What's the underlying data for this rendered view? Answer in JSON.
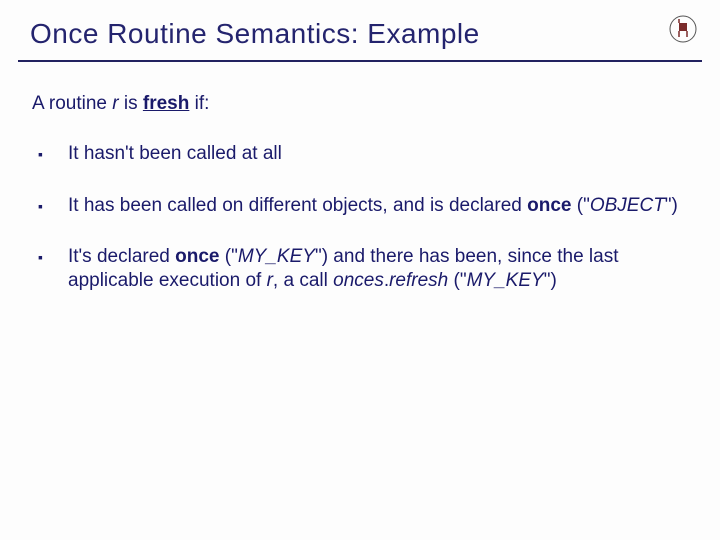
{
  "title": "Once Routine Semantics: Example",
  "logo_name": "eth-chair-logo",
  "intro": {
    "prefix": "A routine ",
    "r": "r",
    "mid": " is ",
    "fresh": "fresh",
    "suffix": " if:"
  },
  "bullets": [
    {
      "plain": "It hasn't been called at all"
    },
    {
      "pre": "It has been called on different objects, and is declared ",
      "once": "once",
      "post_open": " (\"",
      "key": "OBJECT",
      "post_close": "\")"
    },
    {
      "pre": "It's declared ",
      "once": "once",
      "key_open": " (\"",
      "key1": "MY_KEY",
      "key_close": "\") and there has been, since the last applicable execution of ",
      "r": "r",
      "mid2": ", a call ",
      "call_pre": "onces",
      "call_dot": ".",
      "call_method": "refresh",
      "call_args_open": " (\"",
      "key2": "MY_KEY",
      "call_args_close": "\")"
    }
  ]
}
